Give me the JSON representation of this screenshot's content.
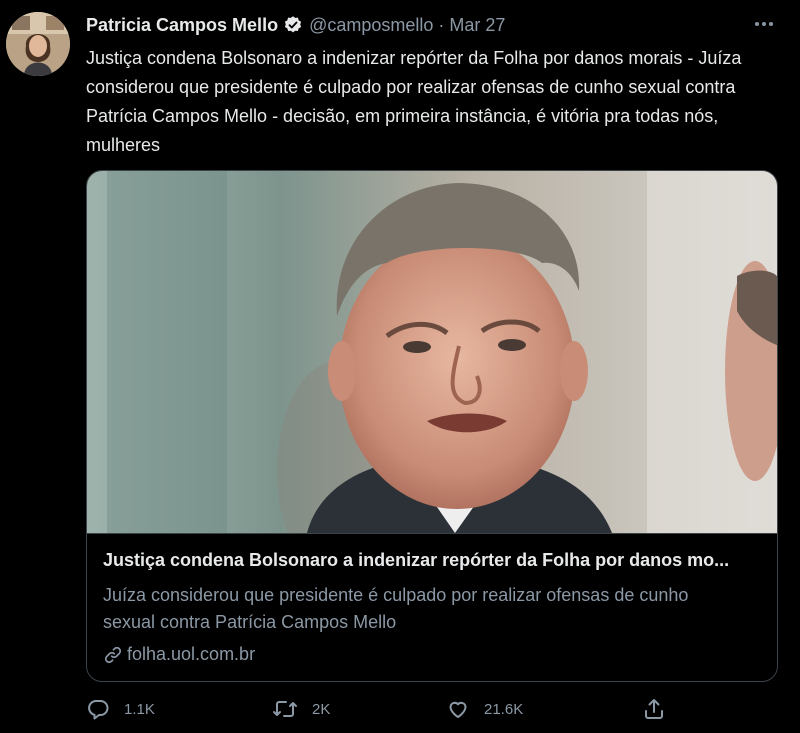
{
  "author": {
    "name": "Patricia Campos Mello",
    "handle": "@camposmello",
    "separator": "·",
    "time": "Mar 27",
    "verified": true,
    "avatar_icon": "profile-photo"
  },
  "tweet": {
    "text": "Justiça condena Bolsonaro a indenizar repórter da Folha por danos morais - Juíza considerou que presidente é culpado por realizar ofensas de cunho sexual contra Patrícia Campos Mello - decisão, em primeira instância, é vitória pra todas nós, mulheres"
  },
  "card": {
    "image_icon": "news-photo",
    "title": "Justiça condena Bolsonaro a indenizar repórter da Folha por danos mo...",
    "description": "Juíza considerou que presidente é culpado por realizar ofensas de cunho sexual contra Patrícia Campos Mello",
    "domain": "folha.uol.com.br"
  },
  "actions": {
    "reply_count": "1.1K",
    "retweet_count": "2K",
    "like_count": "21.6K"
  },
  "colors": {
    "background": "#000000",
    "text": "#e7e9ea",
    "secondary": "#8b98a5",
    "border": "#3c4349",
    "verified": "#e7e9ea"
  }
}
